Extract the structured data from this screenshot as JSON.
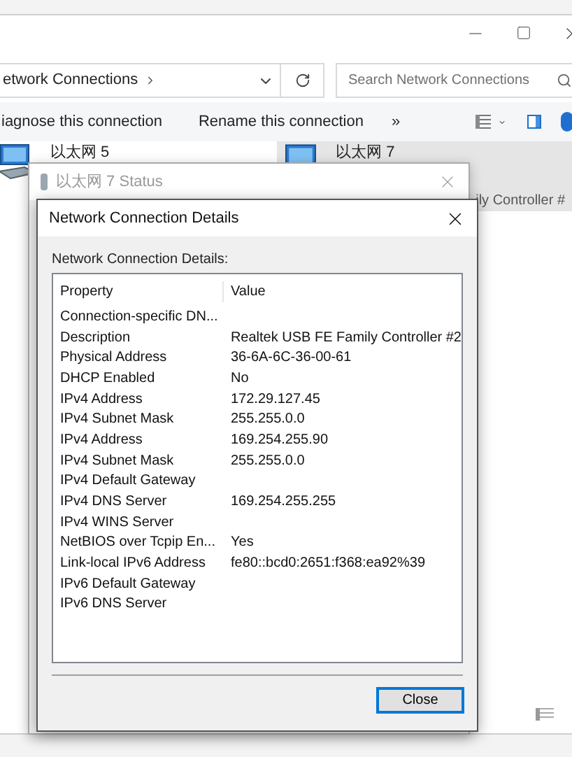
{
  "explorer": {
    "address": {
      "path": "etwork Connections"
    },
    "search": {
      "placeholder": "Search Network Connections"
    },
    "commands": [
      "iagnose this connection",
      "Rename this connection",
      "»"
    ],
    "connections": [
      {
        "name": "以太网 5",
        "selected": false
      },
      {
        "name": "以太网 7",
        "description": "ily Controller #",
        "selected": true
      }
    ]
  },
  "status_dialog": {
    "title": "以太网 7 Status"
  },
  "details_dialog": {
    "title": "Network Connection Details",
    "label": "Network Connection Details:",
    "columns": [
      "Property",
      "Value"
    ],
    "rows": [
      {
        "property": "Connection-specific DN..."
      },
      {
        "property": "Description",
        "value": "Realtek USB FE Family Controller #2"
      },
      {
        "property": "Physical Address",
        "value": "36-6A-6C-36-00-61"
      },
      {
        "property": "DHCP Enabled",
        "value": "No"
      },
      {
        "property": "IPv4 Address",
        "value": "172.29.127.45"
      },
      {
        "property": "IPv4 Subnet Mask",
        "value": "255.255.0.0"
      },
      {
        "property": "IPv4 Address",
        "value": "169.254.255.90"
      },
      {
        "property": "IPv4 Subnet Mask",
        "value": "255.255.0.0"
      },
      {
        "property": "IPv4 Default Gateway"
      },
      {
        "property": "IPv4 DNS Server",
        "value": "169.254.255.255"
      },
      {
        "property": "IPv4 WINS Server"
      },
      {
        "property": "NetBIOS over Tcpip En...",
        "value": "Yes"
      },
      {
        "property": "Link-local IPv6 Address",
        "value": "fe80::bcd0:2651:f368:ea92%39"
      },
      {
        "property": "IPv6 Default Gateway"
      },
      {
        "property": "IPv6 DNS Server"
      }
    ],
    "buttons": [
      {
        "label": "Close",
        "default": true
      }
    ]
  }
}
